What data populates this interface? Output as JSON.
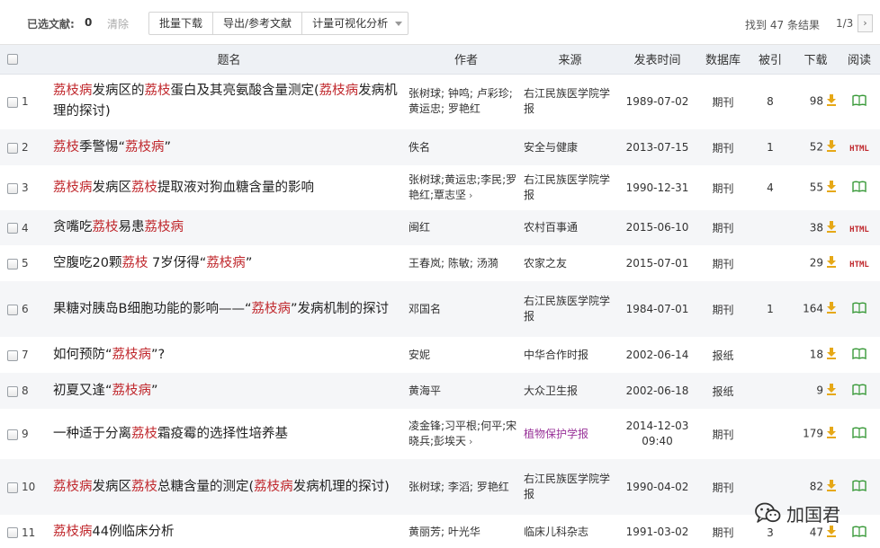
{
  "toolbar": {
    "selected_label": "已选文献:",
    "selected_count": "0",
    "clear_label": "清除",
    "batch_download": "批量下载",
    "export_refs": "导出/参考文献",
    "visual_analysis": "计量可视化分析",
    "found_prefix": "找到",
    "found_count": "47",
    "found_suffix": "条结果",
    "page_info": "1/3",
    "next_icon": "chevron-right-icon"
  },
  "columns": {
    "title": "题名",
    "author": "作者",
    "source": "来源",
    "date": "发表时间",
    "db": "数据库",
    "cited": "被引",
    "downloads": "下载",
    "read": "阅读"
  },
  "rows": [
    {
      "num": "1",
      "title": [
        [
          "h",
          "荔枝病"
        ],
        [
          "n",
          "发病区的"
        ],
        [
          "h",
          "荔枝"
        ],
        [
          "n",
          "蛋白及其亮氨酸含量测定("
        ],
        [
          "h",
          "荔枝病"
        ],
        [
          "n",
          "发病机理的探讨)"
        ]
      ],
      "author": "张树球; 钟鸣; 卢彩珍; 黄运忠; 罗艳红",
      "author_more": false,
      "source": "右江民族医学院学报",
      "source_style": "normal",
      "date": "1989-07-02",
      "db": "期刊",
      "cited": "8",
      "downloads": "98",
      "read": "book"
    },
    {
      "num": "2",
      "title": [
        [
          "h",
          "荔枝"
        ],
        [
          "n",
          "季警惕“"
        ],
        [
          "h",
          "荔枝病"
        ],
        [
          "n",
          "”"
        ]
      ],
      "author": "佚名",
      "author_more": false,
      "source": "安全与健康",
      "source_style": "normal",
      "date": "2013-07-15",
      "db": "期刊",
      "cited": "1",
      "downloads": "52",
      "read": "html"
    },
    {
      "num": "3",
      "title": [
        [
          "h",
          "荔枝病"
        ],
        [
          "n",
          "发病区"
        ],
        [
          "h",
          "荔枝"
        ],
        [
          "n",
          "提取液对狗血糖含量的影响"
        ]
      ],
      "author": "张树球;黄运忠;李民;罗艳红;覃志坚",
      "author_more": true,
      "source": "右江民族医学院学报",
      "source_style": "normal",
      "date": "1990-12-31",
      "db": "期刊",
      "cited": "4",
      "downloads": "55",
      "read": "book"
    },
    {
      "num": "4",
      "title": [
        [
          "n",
          "贪嘴吃"
        ],
        [
          "h",
          "荔枝"
        ],
        [
          "n",
          "易患"
        ],
        [
          "h",
          "荔枝病"
        ]
      ],
      "author": "闽红",
      "author_more": false,
      "source": "农村百事通",
      "source_style": "normal",
      "date": "2015-06-10",
      "db": "期刊",
      "cited": "",
      "downloads": "38",
      "read": "html"
    },
    {
      "num": "5",
      "title": [
        [
          "n",
          "空腹吃20颗"
        ],
        [
          "h",
          "荔枝"
        ],
        [
          "n",
          "  7岁伢得“"
        ],
        [
          "h",
          "荔枝病"
        ],
        [
          "n",
          "”"
        ]
      ],
      "author": "王春岚; 陈敏; 汤漪",
      "author_more": false,
      "source": "农家之友",
      "source_style": "normal",
      "date": "2015-07-01",
      "db": "期刊",
      "cited": "",
      "downloads": "29",
      "read": "html"
    },
    {
      "num": "6",
      "title": [
        [
          "n",
          "果糖对胰岛B细胞功能的影响——“"
        ],
        [
          "h",
          "荔枝病"
        ],
        [
          "n",
          "”发病机制的探讨"
        ]
      ],
      "author": "邓国名",
      "author_more": false,
      "source": "右江民族医学院学报",
      "source_style": "normal",
      "date": "1984-07-01",
      "db": "期刊",
      "cited": "1",
      "downloads": "164",
      "read": "book"
    },
    {
      "num": "7",
      "title": [
        [
          "n",
          "如何预防“"
        ],
        [
          "h",
          "荔枝病"
        ],
        [
          "n",
          "”?"
        ]
      ],
      "author": "安妮",
      "author_more": false,
      "source": "中华合作时报",
      "source_style": "normal",
      "date": "2002-06-14",
      "db": "报纸",
      "cited": "",
      "downloads": "18",
      "read": "book"
    },
    {
      "num": "8",
      "title": [
        [
          "n",
          "初夏又逢“"
        ],
        [
          "h",
          "荔枝病"
        ],
        [
          "n",
          "”"
        ]
      ],
      "author": "黄海平",
      "author_more": false,
      "source": "大众卫生报",
      "source_style": "normal",
      "date": "2002-06-18",
      "db": "报纸",
      "cited": "",
      "downloads": "9",
      "read": "book"
    },
    {
      "num": "9",
      "title": [
        [
          "n",
          "一种适于分离"
        ],
        [
          "h",
          "荔枝"
        ],
        [
          "n",
          "霜疫霉的选择性培养基"
        ]
      ],
      "author": "凌金锋;习平根;何平;宋晓兵;彭埃天",
      "author_more": true,
      "source": "植物保护学报",
      "source_style": "purple",
      "date": "2014-12-03 09:40",
      "db": "期刊",
      "cited": "",
      "downloads": "179",
      "read": "book"
    },
    {
      "num": "10",
      "title": [
        [
          "h",
          "荔枝病"
        ],
        [
          "n",
          "发病区"
        ],
        [
          "h",
          "荔枝"
        ],
        [
          "n",
          "总糖含量的测定("
        ],
        [
          "h",
          "荔枝病"
        ],
        [
          "n",
          "发病机理的探讨)"
        ]
      ],
      "author": "张树球; 李滔; 罗艳红",
      "author_more": false,
      "source": "右江民族医学院学报",
      "source_style": "normal",
      "date": "1990-04-02",
      "db": "期刊",
      "cited": "",
      "downloads": "82",
      "read": "book"
    },
    {
      "num": "11",
      "title": [
        [
          "h",
          "荔枝病"
        ],
        [
          "n",
          "44例临床分析"
        ]
      ],
      "author": "黄丽芳; 叶光华",
      "author_more": false,
      "source": "临床儿科杂志",
      "source_style": "normal",
      "date": "1991-03-02",
      "db": "期刊",
      "cited": "3",
      "downloads": "47",
      "read": "book"
    }
  ],
  "icons": {
    "download": "download-arrow-icon",
    "read_book": "book-icon",
    "read_html": "HTML",
    "wechat": "wechat-icon"
  },
  "colors": {
    "highlight": "#c0282d",
    "header_bg": "#eef1f5",
    "row_alt_bg": "#f5f6f8",
    "download_icon": "#e6a817",
    "book_icon": "#3a9a3a",
    "purple_source": "#993399"
  },
  "watermark": {
    "text": "加国君"
  }
}
